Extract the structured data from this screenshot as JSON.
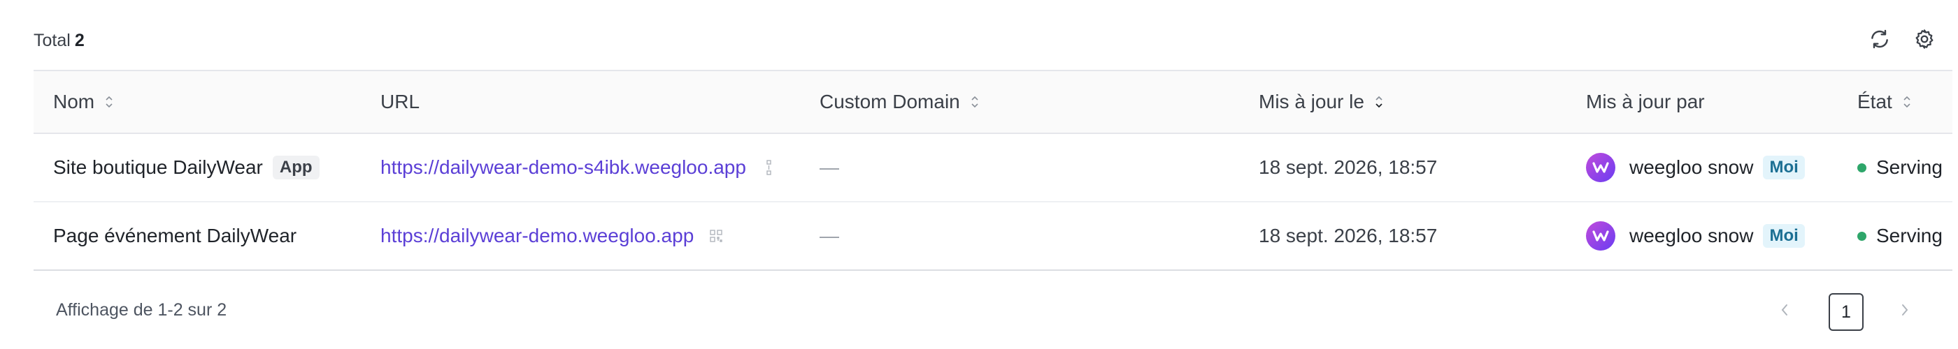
{
  "toolbar": {
    "total_label": "Total",
    "total_count": "2",
    "refresh_icon": "refresh-icon",
    "settings_icon": "gear-icon"
  },
  "columns": {
    "name": "Nom",
    "url": "URL",
    "custom_domain": "Custom Domain",
    "updated_at": "Mis à jour le",
    "updated_by": "Mis à jour par",
    "status": "État"
  },
  "rows": [
    {
      "name": "Site boutique DailyWear",
      "tag": "App",
      "url": "https://dailywear-demo-s4ibk.weegloo.app",
      "custom_domain": "—",
      "updated_at": "18 sept. 2026, 18:57",
      "user": "weegloo snow",
      "user_tag": "Moi",
      "status": "Serving"
    },
    {
      "name": "Page événement DailyWear",
      "tag": "",
      "url": "https://dailywear-demo.weegloo.app",
      "custom_domain": "—",
      "updated_at": "18 sept. 2026, 18:57",
      "user": "weegloo snow",
      "user_tag": "Moi",
      "status": "Serving"
    }
  ],
  "footer": {
    "showing": "Affichage de 1-2 sur 2",
    "current_page": "1"
  },
  "colors": {
    "link": "#5b3fd6",
    "status_serving": "#2ea66a",
    "me_tag_bg": "#e3f4fb"
  }
}
